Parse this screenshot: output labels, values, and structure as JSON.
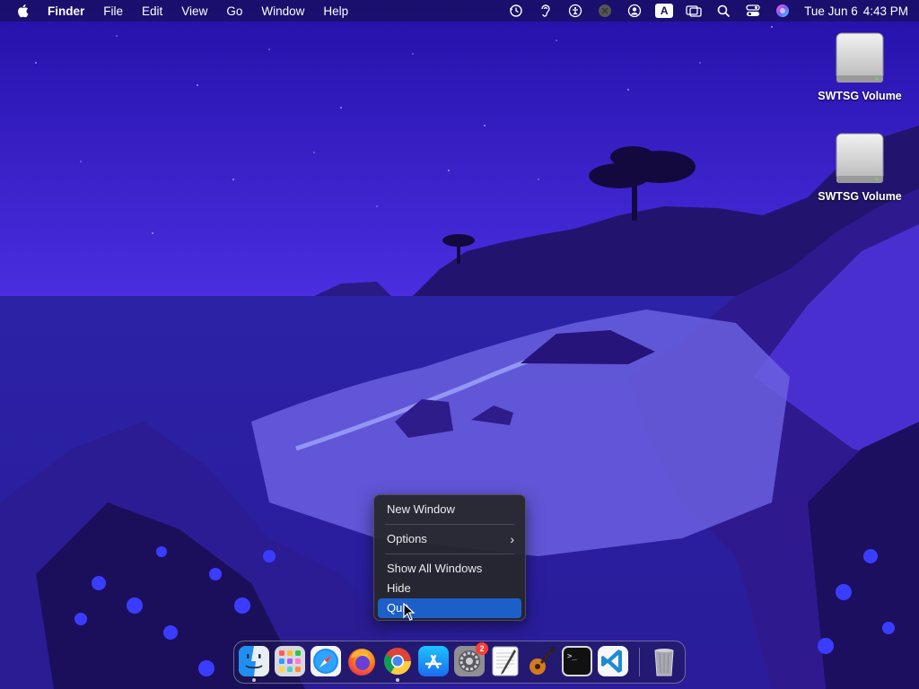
{
  "menubar": {
    "app_name": "Finder",
    "menus": [
      "File",
      "Edit",
      "View",
      "Go",
      "Window",
      "Help"
    ],
    "status_icons": [
      "time-machine-icon",
      "hearing-icon",
      "accessibility-icon",
      "screen-recording-icon",
      "user-icon",
      "input-source-icon",
      "screen-mirroring-icon",
      "spotlight-icon",
      "control-center-icon",
      "siri-icon"
    ],
    "input_source_label": "A",
    "clock": {
      "date": "Tue Jun 6",
      "time": "4:43 PM"
    }
  },
  "desktop": {
    "drives": [
      {
        "label": "SWTSG Volume"
      },
      {
        "label": "SWTSG Volume"
      }
    ]
  },
  "context_menu": {
    "items": [
      {
        "label": "New Window"
      },
      {
        "label": "Options"
      },
      {
        "label": "Show All Windows"
      },
      {
        "label": "Hide"
      },
      {
        "label": "Quit"
      }
    ],
    "chevron": "›"
  },
  "dock": {
    "apps": [
      {
        "name": "finder-icon",
        "running": true
      },
      {
        "name": "launchpad-icon",
        "running": false
      },
      {
        "name": "safari-icon",
        "running": false
      },
      {
        "name": "firefox-icon",
        "running": false
      },
      {
        "name": "chrome-icon",
        "running": true
      },
      {
        "name": "app-store-icon",
        "running": false
      },
      {
        "name": "system-settings-icon",
        "running": false,
        "badge": "2"
      },
      {
        "name": "textedit-icon",
        "running": false
      },
      {
        "name": "garageband-icon",
        "running": false
      },
      {
        "name": "terminal-icon",
        "running": false
      },
      {
        "name": "vscode-icon",
        "running": false
      },
      {
        "name": "trash-icon",
        "running": false
      }
    ],
    "terminal_prompt": ">_"
  },
  "colors": {
    "selection": "#1d5fc9",
    "sky_top": "#2410a8",
    "sky_bottom": "#4a2ee0",
    "water": "#2a22a0"
  }
}
